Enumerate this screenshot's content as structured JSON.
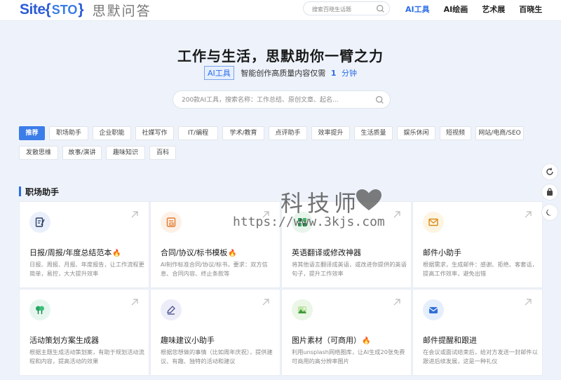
{
  "header": {
    "logo_site": "Site",
    "logo_sto": "STO",
    "logo_cn": "思默问答",
    "search_placeholder": "搜索百晓生话题",
    "nav": [
      {
        "label": "AI工具",
        "active": true
      },
      {
        "label": "AI绘画",
        "active": false
      },
      {
        "label": "艺术展",
        "active": false
      },
      {
        "label": "百晓生",
        "active": false
      }
    ]
  },
  "hero": {
    "title": "工作与生活，思默助你一臂之力",
    "badge": "AI工具",
    "subtitle": "智能创作高质量内容仅需",
    "number": "1",
    "unit": "分钟",
    "search_placeholder": "200款AI工具，搜索名称：工作总结、原创文章、起名..."
  },
  "tags": [
    "推荐",
    "职场助手",
    "企业职能",
    "社媒写作",
    "IT/编程",
    "学术/教育",
    "点评助手",
    "效率提升",
    "生活质量",
    "娱乐休闲",
    "短视频",
    "网站/电商/SEO",
    "发散思维",
    "故事/演讲",
    "趣味知识",
    "百科"
  ],
  "active_tag": "推荐",
  "section": {
    "title": "职场助手"
  },
  "cards": [
    {
      "title": "日报/周报/年度总结范本",
      "hot": true,
      "icon": "edit-document-icon",
      "desc": "日报、周报、月报、年度报告，让工作流程更简单，易控，大大提升效率"
    },
    {
      "title": "合同/协议/标书模板",
      "hot": true,
      "icon": "contract-icon",
      "desc": "AI制作标准合同/协议/标书，要求：双方信息、合同内容、终止条款等"
    },
    {
      "title": "英语翻译或修改神器",
      "hot": false,
      "icon": "translate-icon",
      "desc": "将其他语言翻译成英语，或改进你提供的英语句子，提升工作效率"
    },
    {
      "title": "邮件小助手",
      "hot": false,
      "icon": "mail-icon",
      "desc": "根据需求，生成邮件：感谢、拒绝、客套话，提高工作效率，避免出错"
    },
    {
      "title": "活动策划方案生成器",
      "hot": false,
      "icon": "tree-icon",
      "desc": "根据主题生成活动策划案，有助于规划活动流程和内容，提高活动的效果"
    },
    {
      "title": "趣味建议小助手",
      "hot": false,
      "icon": "pen-icon",
      "desc": "根据您想做的事情（比如周年庆祝），提供建议、有趣、独特的活动和建议"
    },
    {
      "title": "图片素材（可商用）",
      "hot": true,
      "icon": "image-icon",
      "desc": "利用unsplash网络图库，让AI生成20张免费可商用的高分辨率图片"
    },
    {
      "title": "邮件提醒和跟进",
      "hot": false,
      "icon": "mail-reminder-icon",
      "desc": "在会议或面试结束后，给对方发送一封邮件以跟进后续发展，这是一种礼仪"
    }
  ],
  "flame_glyph": "🔥",
  "watermark": {
    "line1": "科技师",
    "line2": "https://www.3kjs.com"
  },
  "colors": {
    "accent": "#2b6de8",
    "background": "#eef3fb"
  }
}
